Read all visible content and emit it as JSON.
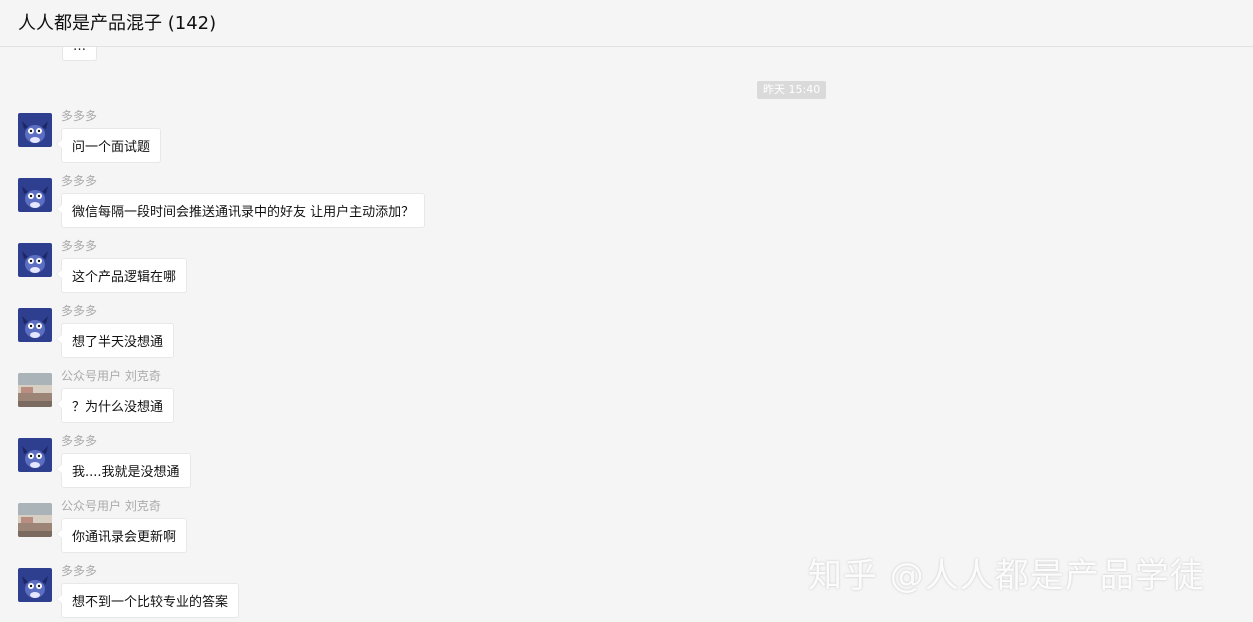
{
  "window": {
    "title": "人人都是产品混子 (142)"
  },
  "chat": {
    "partial_top_text": "…",
    "timestamp": "昨天 15:40",
    "messages": [
      {
        "sender": "多多多",
        "avatar": "tom-avatar",
        "text": "问一个面试题"
      },
      {
        "sender": "多多多",
        "avatar": "tom-avatar",
        "text": "微信每隔一段时间会推送通讯录中的好友 让用户主动添加？"
      },
      {
        "sender": "多多多",
        "avatar": "tom-avatar",
        "text": "这个产品逻辑在哪"
      },
      {
        "sender": "多多多",
        "avatar": "tom-avatar",
        "text": "想了半天没想通"
      },
      {
        "sender": "公众号用户 刘克奇",
        "avatar": "photo-avatar",
        "text": "？为什么没想通"
      },
      {
        "sender": "多多多",
        "avatar": "tom-avatar",
        "text": "我....我就是没想通"
      },
      {
        "sender": "公众号用户 刘克奇",
        "avatar": "photo-avatar",
        "text": "你通讯录会更新啊"
      },
      {
        "sender": "多多多",
        "avatar": "tom-avatar",
        "text": "想不到一个比较专业的答案"
      }
    ]
  },
  "watermark": "知乎 @人人都是产品学徒",
  "colors": {
    "background": "#f5f5f5",
    "bubble": "#ffffff",
    "sender": "#aaaaaa",
    "tom_avatar": "#2f3f8f"
  }
}
